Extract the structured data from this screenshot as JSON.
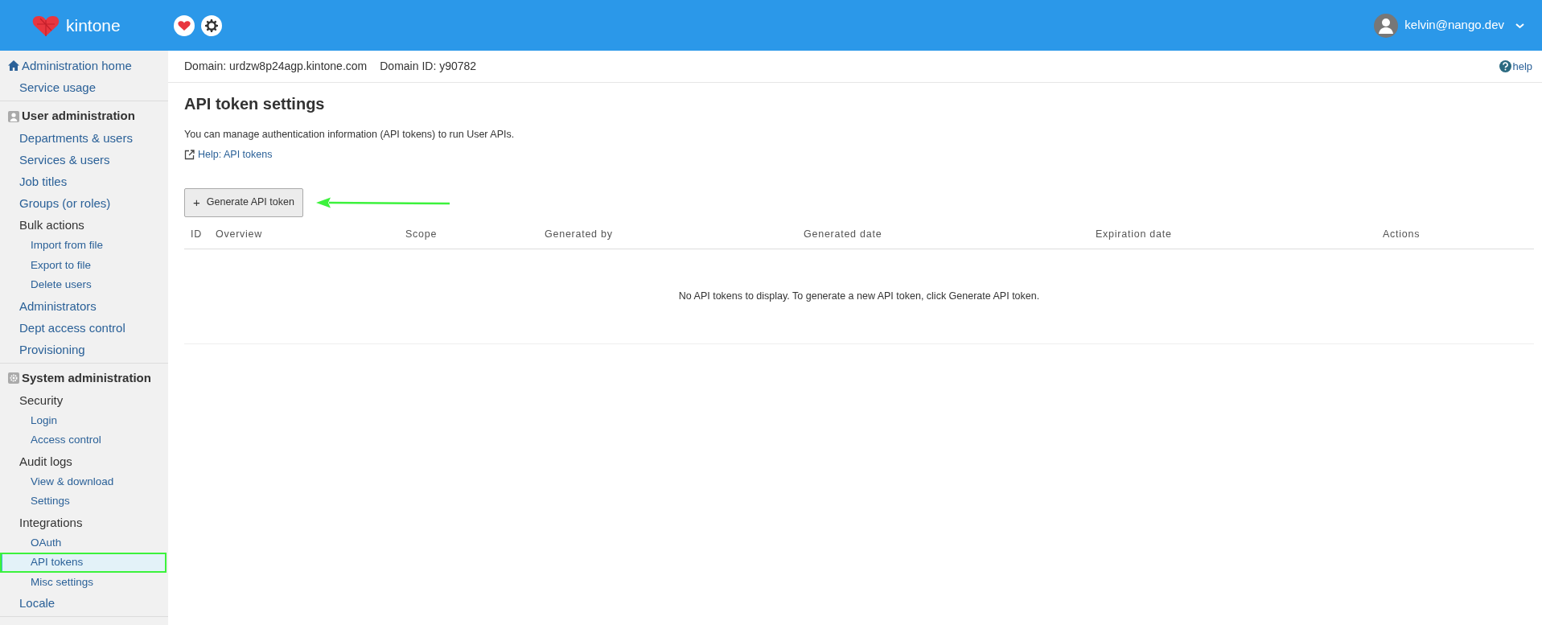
{
  "header": {
    "logo_text": "kintone",
    "user": "kelvin@nango.dev"
  },
  "sidebar": {
    "sections": [
      {
        "items": [
          {
            "label": "Administration home",
            "kind": "home",
            "selected": false
          },
          {
            "label": "Service usage",
            "kind": "link",
            "selected": false
          }
        ]
      },
      {
        "heading": "User administration",
        "items": [
          {
            "label": "Departments & users",
            "kind": "link",
            "selected": false
          },
          {
            "label": "Services & users",
            "kind": "link",
            "selected": false
          },
          {
            "label": "Job titles",
            "kind": "link",
            "selected": false
          },
          {
            "label": "Groups (or roles)",
            "kind": "link",
            "selected": false
          },
          {
            "label": "Bulk actions",
            "kind": "category",
            "selected": false,
            "children": [
              {
                "label": "Import from file",
                "kind": "link",
                "selected": false
              },
              {
                "label": "Export to file",
                "kind": "link",
                "selected": false
              },
              {
                "label": "Delete users",
                "kind": "link",
                "selected": false
              }
            ]
          },
          {
            "label": "Administrators",
            "kind": "link",
            "selected": false
          },
          {
            "label": "Dept access control",
            "kind": "link",
            "selected": false
          },
          {
            "label": "Provisioning",
            "kind": "link",
            "selected": false
          }
        ]
      },
      {
        "heading": "System administration",
        "items": [
          {
            "label": "Security",
            "kind": "category",
            "selected": false,
            "children": [
              {
                "label": "Login",
                "kind": "link",
                "selected": false
              },
              {
                "label": "Access control",
                "kind": "link",
                "selected": false
              }
            ]
          },
          {
            "label": "Audit logs",
            "kind": "category",
            "selected": false,
            "children": [
              {
                "label": "View & download",
                "kind": "link",
                "selected": false
              },
              {
                "label": "Settings",
                "kind": "link",
                "selected": false
              }
            ]
          },
          {
            "label": "Integrations",
            "kind": "category",
            "selected": false,
            "children": [
              {
                "label": "OAuth",
                "kind": "link",
                "selected": false
              },
              {
                "label": "API tokens",
                "kind": "link",
                "selected": true
              },
              {
                "label": "Misc settings",
                "kind": "link",
                "selected": false
              }
            ]
          },
          {
            "label": "Locale",
            "kind": "link",
            "selected": false
          }
        ]
      }
    ]
  },
  "domain_bar": {
    "domain": "Domain: urdzw8p24agp.kintone.com",
    "domain_id": "Domain ID: y90782",
    "help": "help"
  },
  "page": {
    "title": "API token settings",
    "description": "You can manage authentication information (API tokens) to run User APIs.",
    "help_link": "Help: API tokens",
    "generate_button": "Generate API token",
    "button_icon": "+"
  },
  "table": {
    "columns": [
      "ID",
      "Overview",
      "Scope",
      "Generated by",
      "Generated date",
      "Expiration date",
      "Actions"
    ],
    "empty_message": "No API tokens to display. To generate a new API token, click Generate API token."
  }
}
